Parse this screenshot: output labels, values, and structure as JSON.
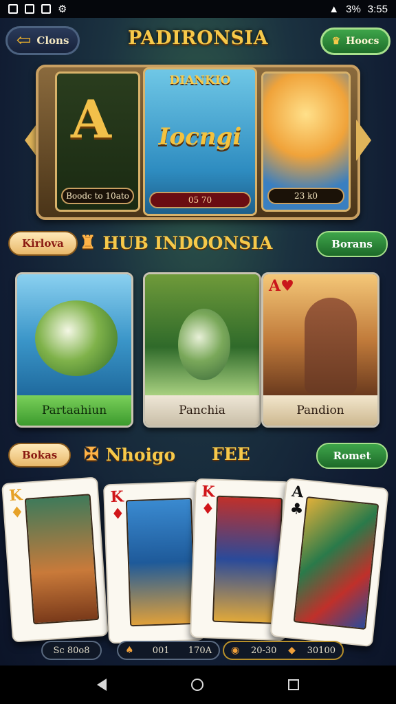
{
  "status": {
    "battery": "3%",
    "time": "3:55"
  },
  "header": {
    "back_label": "Clons",
    "title": "PADIRONSIA",
    "home_label": "Hoocs"
  },
  "showcase": {
    "cards": [
      {
        "value": "Boodc to 10ato"
      },
      {
        "banner": "DIANKIO",
        "word": "Iocngi",
        "value": "05 70"
      },
      {
        "value": "23 k0"
      }
    ]
  },
  "section1": {
    "tag": "Kirlova",
    "title": "HUB INDOONSIA",
    "button": "Borans"
  },
  "games": [
    {
      "label": "Partaahiun"
    },
    {
      "label": "Panchia"
    },
    {
      "label": "Pandion"
    }
  ],
  "section2": {
    "tag": "Bokas",
    "title": "Nhoigo",
    "extra": "FEE",
    "button": "Romet"
  },
  "cards": [
    {
      "rank": "K",
      "suit": "♦"
    },
    {
      "rank": "K",
      "suit": "♦"
    },
    {
      "rank": "K",
      "suit": "♦"
    },
    {
      "rank": "A",
      "suit": "♣"
    }
  ],
  "footer": {
    "pill1": "Sc 80o8",
    "pill2_a": "001",
    "pill2_b": "170A",
    "pill3_a": "20-30",
    "pill3_b": "30100"
  }
}
